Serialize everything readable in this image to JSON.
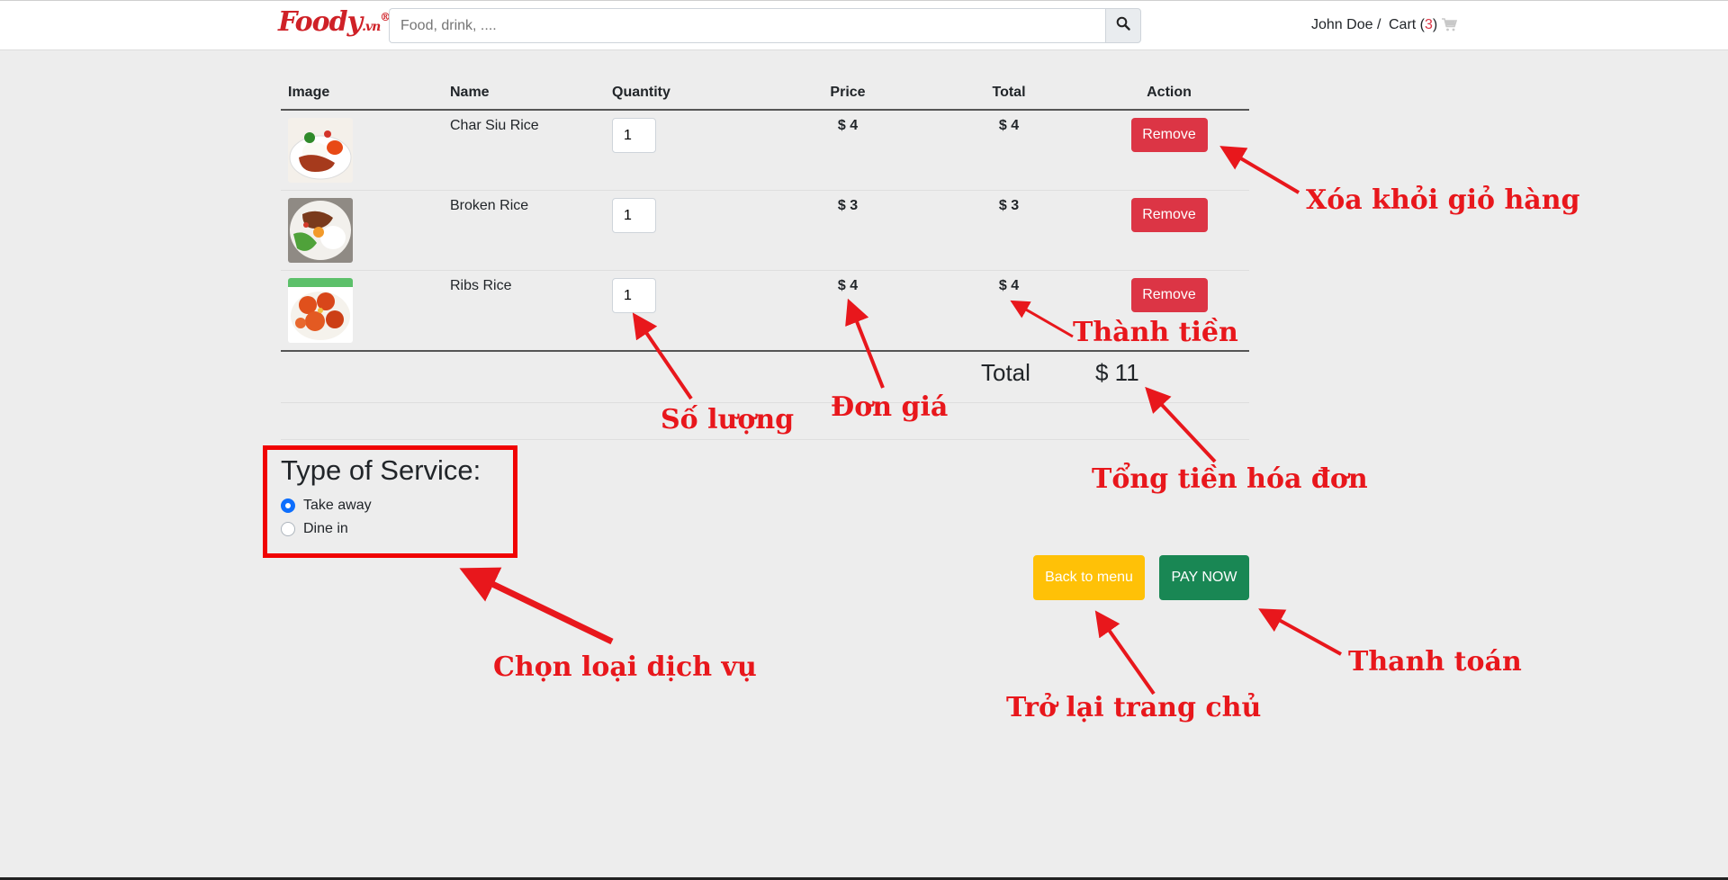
{
  "header": {
    "logo": "Foody",
    "logo_suffix": ".vn",
    "logo_reg": "®",
    "search_placeholder": "Food, drink, ....",
    "user": "John Doe /",
    "cart_label": "Cart (",
    "cart_count": "3",
    "cart_close": ")"
  },
  "table": {
    "headers": [
      "Image",
      "Name",
      "Quantity",
      "Price",
      "Total",
      "Action"
    ],
    "items": [
      {
        "name": "Char Siu Rice",
        "qty": "1",
        "price": "$ 4",
        "total": "$ 4",
        "action": "Remove"
      },
      {
        "name": "Broken Rice",
        "qty": "1",
        "price": "$ 3",
        "total": "$ 3",
        "action": "Remove"
      },
      {
        "name": "Ribs Rice",
        "qty": "1",
        "price": "$ 4",
        "total": "$ 4",
        "action": "Remove"
      }
    ]
  },
  "summary": {
    "total_label": "Total",
    "total_value": "$ 11"
  },
  "service": {
    "title": "Type of Service:",
    "options": [
      {
        "label": "Take away",
        "checked": true
      },
      {
        "label": "Dine in",
        "checked": false
      }
    ]
  },
  "buttons": {
    "back": "Back to menu",
    "pay": "PAY NOW"
  },
  "annotations": {
    "remove": "Xóa khỏi giỏ hàng",
    "line_total": "Thành tiền",
    "quantity": "Số lượng",
    "unit_price": "Đơn giá",
    "grand_total": "Tổng tiền hóa đơn",
    "service_type": "Chọn loại dịch vụ",
    "back_home": "Trở lại trang chủ",
    "checkout": "Thanh toán"
  },
  "colors": {
    "accent_red": "#dc3545",
    "annotation_red": "#e8171c",
    "pay_green": "#198754",
    "back_yellow": "#ffc107",
    "radio_blue": "#0d6efd"
  }
}
